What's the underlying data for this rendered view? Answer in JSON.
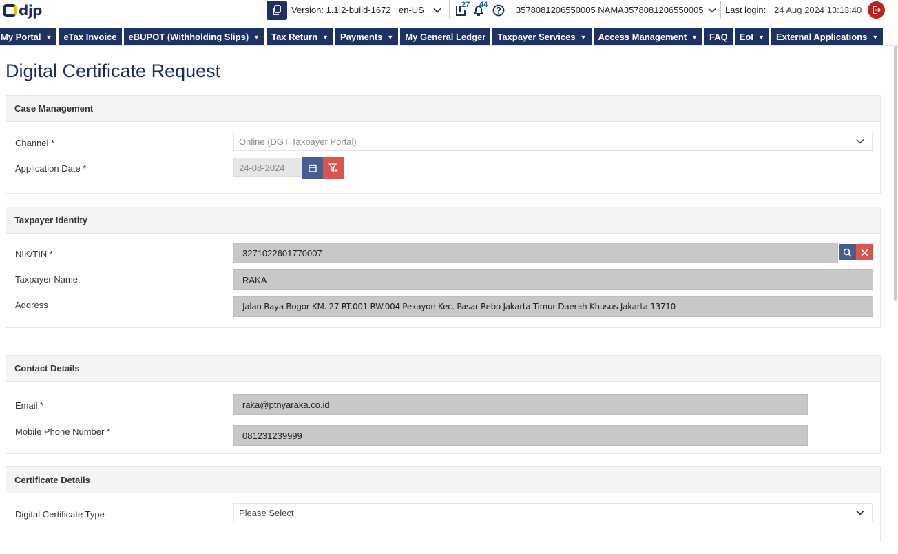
{
  "header": {
    "logo_text": "djp",
    "version": "Version: 1.1.2-build-1672",
    "language": "en-US",
    "docs_badge": "27",
    "notifications_badge": "44",
    "user": "3578081206550005 NAMA3578081206550005",
    "last_login_label": "Last login:",
    "last_login_value": "24 Aug 2024 13:13:40"
  },
  "nav": [
    {
      "label": "My Portal",
      "has_menu": true
    },
    {
      "label": "eTax Invoice",
      "has_menu": false
    },
    {
      "label": "eBUPOT (Withholding Slips)",
      "has_menu": true
    },
    {
      "label": "Tax Return",
      "has_menu": true
    },
    {
      "label": "Payments",
      "has_menu": true
    },
    {
      "label": "My General Ledger",
      "has_menu": false
    },
    {
      "label": "Taxpayer Services",
      "has_menu": true
    },
    {
      "label": "Access Management",
      "has_menu": true
    },
    {
      "label": "FAQ",
      "has_menu": false
    },
    {
      "label": "EoI",
      "has_menu": true
    },
    {
      "label": "External Applications",
      "has_menu": true
    }
  ],
  "page": {
    "title": "Digital Certificate Request"
  },
  "case_management": {
    "title": "Case Management",
    "channel_label": "Channel *",
    "channel_value": "Online (DGT Taxpayer Portal)",
    "application_date_label": "Application Date *",
    "application_date_value": "24-08-2024"
  },
  "taxpayer_identity": {
    "title": "Taxpayer Identity",
    "nik_label": "NIK/TIN *",
    "nik_value": "3271022601770007",
    "name_label": "Taxpayer Name",
    "name_value": "RAKA",
    "address_label": "Address",
    "address_value": "Jalan Raya Bogor KM. 27 RT.001 RW.004 Pekayon Kec. Pasar Rebo Jakarta Timur Daerah Khusus Jakarta 13710"
  },
  "contact_details": {
    "title": "Contact Details",
    "email_label": "Email  *",
    "email_value": "raka@ptnyaraka.co.id",
    "phone_label": "Mobile Phone Number  *",
    "phone_value": "081231239999"
  },
  "certificate_details": {
    "title": "Certificate Details",
    "type_label": "Digital Certificate Type",
    "type_placeholder": "Please Select"
  },
  "colors": {
    "navy": "#1f3163",
    "danger": "#d9534f",
    "calendar_button": "#495c8e",
    "logout": "#c0201b"
  },
  "icons": [
    "copy-icon",
    "chevron-down-icon",
    "document-icon",
    "bell-icon",
    "help-icon",
    "logout-icon",
    "calendar-icon",
    "filter-clear-icon",
    "search-icon",
    "close-icon"
  ]
}
